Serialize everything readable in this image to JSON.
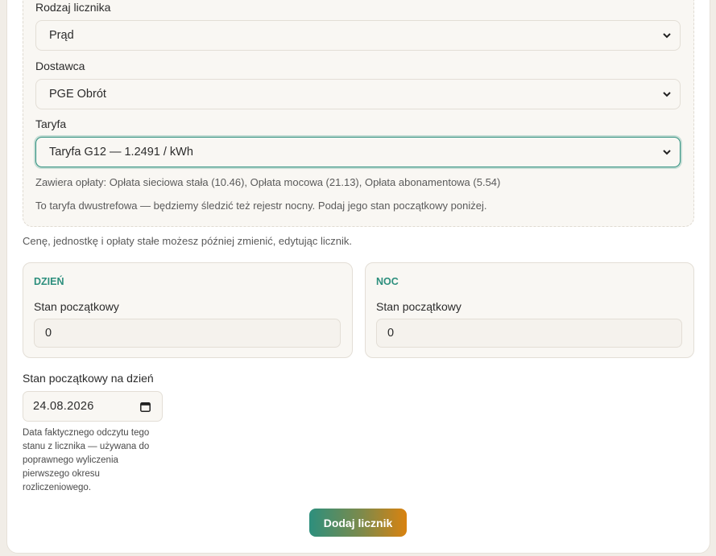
{
  "meter_type": {
    "label": "Rodzaj licznika",
    "value": "Prąd"
  },
  "supplier": {
    "label": "Dostawca",
    "value": "PGE Obrót"
  },
  "tariff": {
    "label": "Taryfa",
    "value": "Taryfa G12 — 1.2491 / kWh",
    "fees_note": "Zawiera opłaty: Opłata sieciowa stała (10.46), Opłata mocowa (21.13), Opłata abonamentowa (5.54)",
    "dual_note": "To taryfa dwustrefowa — będziemy śledzić też rejestr nocny. Podaj jego stan początkowy poniżej."
  },
  "edit_note": "Cenę, jednostkę i opłaty stałe możesz później zmienić, edytując licznik.",
  "zones": [
    {
      "title": "DZIEŃ",
      "label": "Stan początkowy",
      "value": "0"
    },
    {
      "title": "NOC",
      "label": "Stan początkowy",
      "value": "0"
    }
  ],
  "start_date": {
    "label": "Stan początkowy na dzień",
    "value": "24.08.2026",
    "help": "Data faktycznego odczytu tego stanu z licznika — używana do poprawnego wyliczenia pierwszego okresu rozliczeniowego."
  },
  "submit_label": "Dodaj licznik",
  "colors": {
    "accent": "#2d8f7d",
    "button_end": "#d9820f"
  }
}
